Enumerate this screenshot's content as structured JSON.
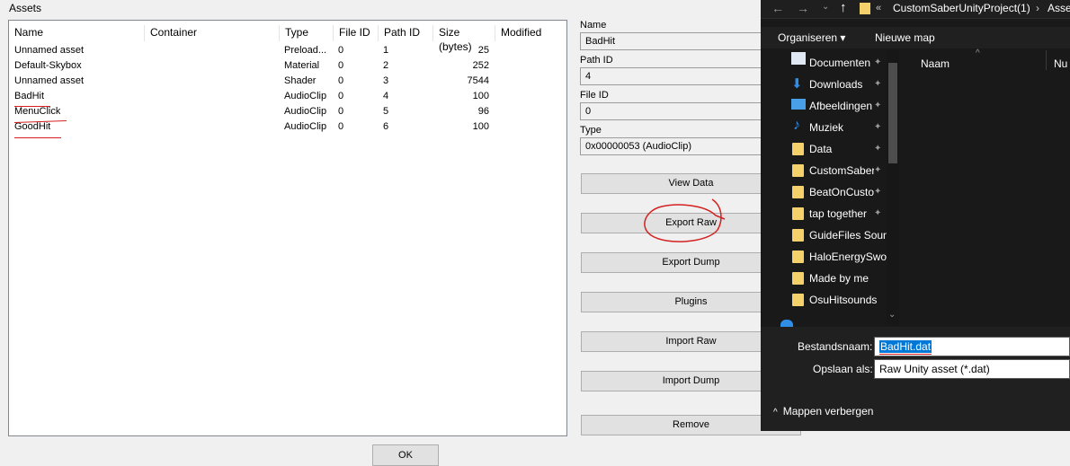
{
  "assets_panel": {
    "title": "Assets",
    "columns": [
      "Name",
      "Container",
      "Type",
      "File ID",
      "Path ID",
      "Size (bytes)",
      "Modified"
    ],
    "rows": [
      {
        "name": "Unnamed asset",
        "container": "",
        "type": "Preload...",
        "file_id": "0",
        "path_id": "1",
        "size": "25",
        "modified": ""
      },
      {
        "name": "Default-Skybox",
        "container": "",
        "type": "Material",
        "file_id": "0",
        "path_id": "2",
        "size": "252",
        "modified": ""
      },
      {
        "name": "Unnamed asset",
        "container": "",
        "type": "Shader",
        "file_id": "0",
        "path_id": "3",
        "size": "7544",
        "modified": ""
      },
      {
        "name": "BadHit",
        "container": "",
        "type": "AudioClip",
        "file_id": "0",
        "path_id": "4",
        "size": "100",
        "modified": ""
      },
      {
        "name": "MenuClick",
        "container": "",
        "type": "AudioClip",
        "file_id": "0",
        "path_id": "5",
        "size": "96",
        "modified": ""
      },
      {
        "name": "GoodHit",
        "container": "",
        "type": "AudioClip",
        "file_id": "0",
        "path_id": "6",
        "size": "100",
        "modified": ""
      }
    ],
    "ok_label": "OK"
  },
  "details": {
    "name_label": "Name",
    "name_value": "BadHit",
    "path_id_label": "Path ID",
    "path_id_value": "4",
    "file_id_label": "File ID",
    "file_id_value": "0",
    "type_label": "Type",
    "type_value": "0x00000053 (AudioClip)"
  },
  "actions": {
    "view_data": "View Data",
    "export_raw": "Export Raw",
    "export_dump": "Export Dump",
    "plugins": "Plugins",
    "import_raw": "Import Raw",
    "import_dump": "Import Dump",
    "remove": "Remove"
  },
  "save_dialog": {
    "breadcrumb_prefix": "«",
    "breadcrumb_1": "CustomSaberUnityProject(1)",
    "breadcrumb_sep": "›",
    "breadcrumb_2": "Asse",
    "organize_label": "Organiseren",
    "new_folder_label": "Nieuwe map",
    "column_name": "Naam",
    "column_number": "Nu",
    "nav_items": [
      {
        "label": "Documenten",
        "icon": "documents-icon"
      },
      {
        "label": "Downloads",
        "icon": "downloads-icon"
      },
      {
        "label": "Afbeeldingen",
        "icon": "pictures-icon"
      },
      {
        "label": "Muziek",
        "icon": "music-icon"
      },
      {
        "label": "Data",
        "icon": "folder-icon"
      },
      {
        "label": "CustomSaber",
        "icon": "folder-icon"
      },
      {
        "label": "BeatOnCusto",
        "icon": "folder-icon"
      },
      {
        "label": "tap together",
        "icon": "folder-icon"
      },
      {
        "label": "GuideFiles Sound",
        "icon": "folder-icon"
      },
      {
        "label": "HaloEnergySwor",
        "icon": "folder-icon"
      },
      {
        "label": "Made by me",
        "icon": "folder-icon"
      },
      {
        "label": "OsuHitsounds",
        "icon": "folder-icon"
      }
    ],
    "filename_label": "Bestandsnaam:",
    "filename_value": "BadHit.dat",
    "savetype_label": "Opslaan als:",
    "savetype_value": "Raw Unity asset (*.dat)",
    "hide_folders_label": "Mappen verbergen"
  },
  "colors": {
    "annotation": "#d42020",
    "selection": "#0078d7",
    "folder": "#f4d16a"
  }
}
